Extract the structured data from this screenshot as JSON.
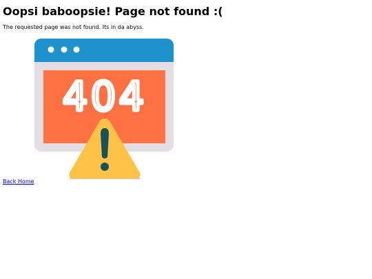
{
  "page": {
    "heading": "Oopsi baboopsie! Page not found :(",
    "description": "The requested page was not found. Its in da abyss.",
    "back_link": "Back Home"
  },
  "illustration": {
    "error_code": "404",
    "icons": [
      "browser-window-icon",
      "warning-triangle-icon"
    ],
    "colors": {
      "window_bar": "#1e92cc",
      "window_frame": "#e3dee3",
      "screen": "#ff7143",
      "screen_text": "#ffffff",
      "warning": "#ffc247",
      "exclamation": "#16515c"
    }
  }
}
